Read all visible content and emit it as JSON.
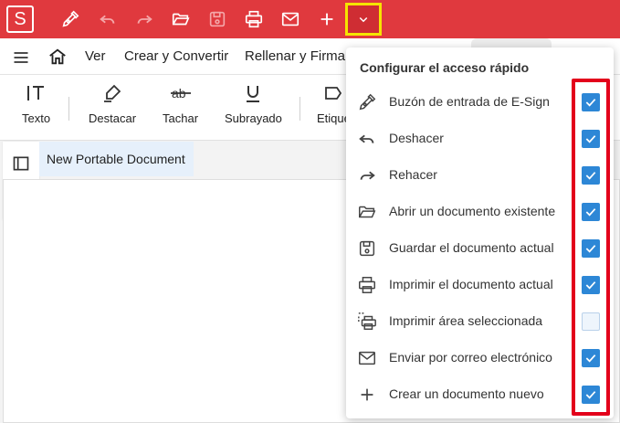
{
  "app": {
    "logo_letter": "S",
    "brand_color": "#e0393e",
    "highlight_color": "#f5e400"
  },
  "menu": {
    "items": [
      "Ver",
      "Crear y Convertir",
      "Rellenar y Firmar"
    ]
  },
  "toolbar": {
    "tools": [
      {
        "label": "Texto",
        "icon": "text-tool-icon"
      },
      {
        "label": "Destacar",
        "icon": "highlighter-icon"
      },
      {
        "label": "Tachar",
        "icon": "strikethrough-icon"
      },
      {
        "label": "Subrayado",
        "icon": "underline-icon"
      },
      {
        "label": "Etique",
        "icon": "label-icon"
      }
    ]
  },
  "document": {
    "tab_title": "New Portable Document"
  },
  "quick_access": {
    "title": "Configurar el acceso rápido",
    "items": [
      {
        "label": "Buzón de entrada de E-Sign",
        "icon": "pen-nib-icon",
        "checked": true
      },
      {
        "label": "Deshacer",
        "icon": "undo-icon",
        "checked": true
      },
      {
        "label": "Rehacer",
        "icon": "redo-icon",
        "checked": true
      },
      {
        "label": "Abrir un documento existente",
        "icon": "folder-open-icon",
        "checked": true
      },
      {
        "label": "Guardar el documento actual",
        "icon": "save-icon",
        "checked": true
      },
      {
        "label": "Imprimir el documento actual",
        "icon": "print-icon",
        "checked": true
      },
      {
        "label": "Imprimir área seleccionada",
        "icon": "print-area-icon",
        "checked": false
      },
      {
        "label": "Enviar por correo electrónico",
        "icon": "mail-icon",
        "checked": true
      },
      {
        "label": "Crear un documento nuevo",
        "icon": "plus-icon",
        "checked": true
      }
    ]
  }
}
